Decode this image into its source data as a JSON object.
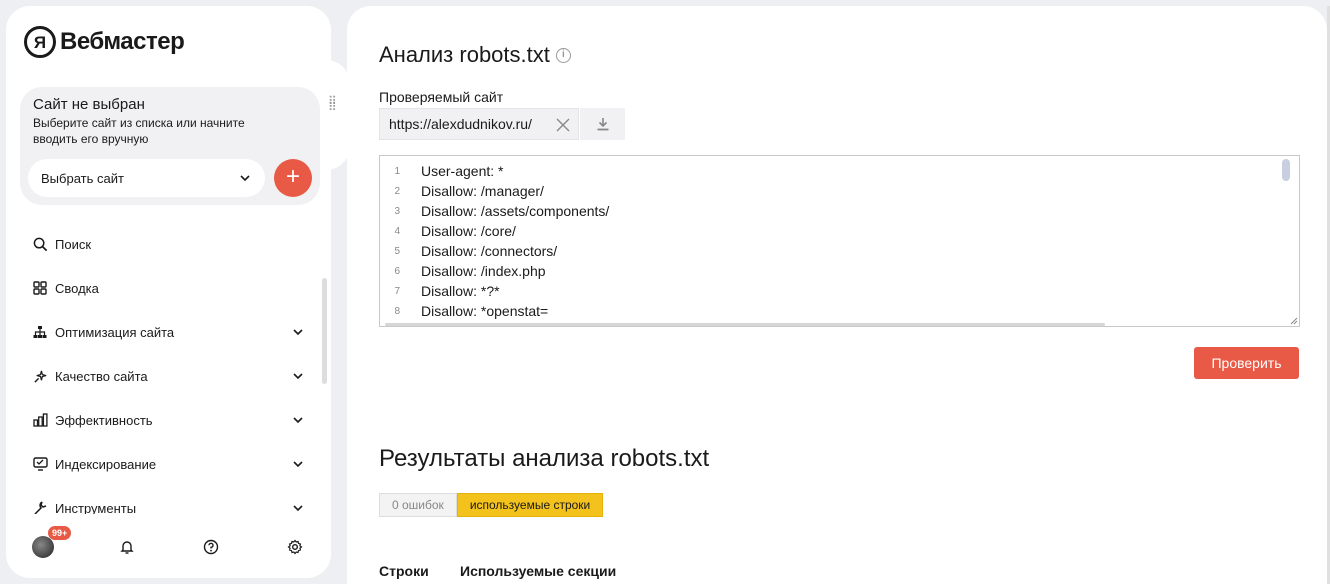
{
  "brand": {
    "logo_letter": "Я",
    "name": "Вебмастер"
  },
  "site_box": {
    "title": "Сайт не выбран",
    "description": "Выберите сайт из списка или начните вводить его вручную",
    "select_label": "Выбрать сайт",
    "add_label": "+"
  },
  "nav": [
    {
      "label": "Поиск",
      "icon": "search-icon",
      "has_chevron": false
    },
    {
      "label": "Сводка",
      "icon": "grid-icon",
      "has_chevron": false
    },
    {
      "label": "Оптимизация сайта",
      "icon": "sitemap-icon",
      "has_chevron": true
    },
    {
      "label": "Качество сайта",
      "icon": "sparkle-icon",
      "has_chevron": true
    },
    {
      "label": "Эффективность",
      "icon": "bar-chart-icon",
      "has_chevron": true
    },
    {
      "label": "Индексирование",
      "icon": "monitor-icon",
      "has_chevron": true
    },
    {
      "label": "Инструменты",
      "icon": "wrench-icon",
      "has_chevron": true
    }
  ],
  "bottom": {
    "badge": "99+"
  },
  "main": {
    "title": "Анализ robots.txt",
    "site_label": "Проверяемый сайт",
    "site_value": "https://alexdudnikov.ru/",
    "robots_lines": [
      {
        "n": "1",
        "text": "User-agent: *"
      },
      {
        "n": "2",
        "text": "Disallow: /manager/"
      },
      {
        "n": "3",
        "text": "Disallow: /assets/components/"
      },
      {
        "n": "4",
        "text": "Disallow: /core/"
      },
      {
        "n": "5",
        "text": "Disallow: /connectors/"
      },
      {
        "n": "6",
        "text": "Disallow: /index.php"
      },
      {
        "n": "7",
        "text": "Disallow: *?*"
      },
      {
        "n": "8",
        "text": "Disallow: *openstat="
      }
    ],
    "check_label": "Проверить",
    "results_title": "Результаты анализа robots.txt",
    "tabs": [
      {
        "label": "0 ошибок",
        "active": false
      },
      {
        "label": "используемые строки",
        "active": true
      }
    ],
    "columns": [
      "Строки",
      "Используемые секции"
    ]
  },
  "colors": {
    "accent": "#e85a45",
    "tab_active": "#f3c21d"
  }
}
